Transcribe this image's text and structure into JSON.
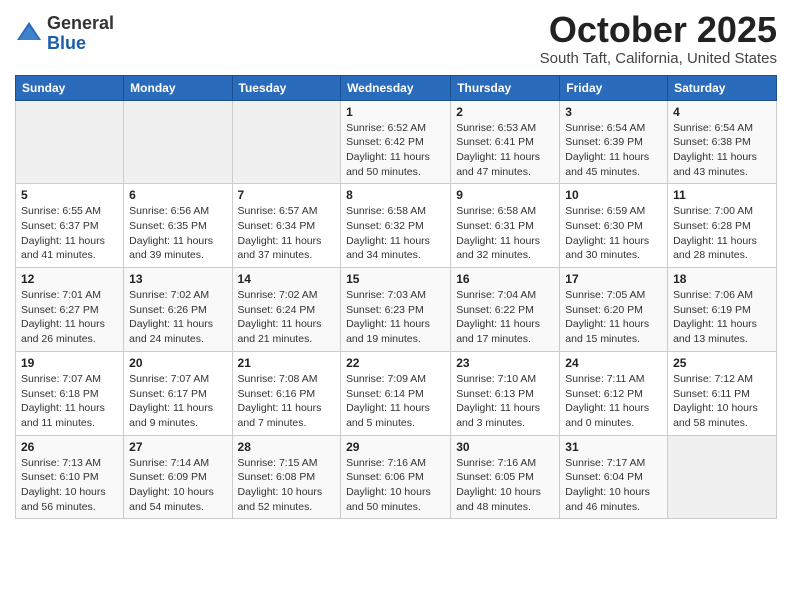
{
  "header": {
    "logo_line1": "General",
    "logo_line2": "Blue",
    "month": "October 2025",
    "location": "South Taft, California, United States"
  },
  "weekdays": [
    "Sunday",
    "Monday",
    "Tuesday",
    "Wednesday",
    "Thursday",
    "Friday",
    "Saturday"
  ],
  "weeks": [
    [
      {
        "day": "",
        "info": ""
      },
      {
        "day": "",
        "info": ""
      },
      {
        "day": "",
        "info": ""
      },
      {
        "day": "1",
        "info": "Sunrise: 6:52 AM\nSunset: 6:42 PM\nDaylight: 11 hours\nand 50 minutes."
      },
      {
        "day": "2",
        "info": "Sunrise: 6:53 AM\nSunset: 6:41 PM\nDaylight: 11 hours\nand 47 minutes."
      },
      {
        "day": "3",
        "info": "Sunrise: 6:54 AM\nSunset: 6:39 PM\nDaylight: 11 hours\nand 45 minutes."
      },
      {
        "day": "4",
        "info": "Sunrise: 6:54 AM\nSunset: 6:38 PM\nDaylight: 11 hours\nand 43 minutes."
      }
    ],
    [
      {
        "day": "5",
        "info": "Sunrise: 6:55 AM\nSunset: 6:37 PM\nDaylight: 11 hours\nand 41 minutes."
      },
      {
        "day": "6",
        "info": "Sunrise: 6:56 AM\nSunset: 6:35 PM\nDaylight: 11 hours\nand 39 minutes."
      },
      {
        "day": "7",
        "info": "Sunrise: 6:57 AM\nSunset: 6:34 PM\nDaylight: 11 hours\nand 37 minutes."
      },
      {
        "day": "8",
        "info": "Sunrise: 6:58 AM\nSunset: 6:32 PM\nDaylight: 11 hours\nand 34 minutes."
      },
      {
        "day": "9",
        "info": "Sunrise: 6:58 AM\nSunset: 6:31 PM\nDaylight: 11 hours\nand 32 minutes."
      },
      {
        "day": "10",
        "info": "Sunrise: 6:59 AM\nSunset: 6:30 PM\nDaylight: 11 hours\nand 30 minutes."
      },
      {
        "day": "11",
        "info": "Sunrise: 7:00 AM\nSunset: 6:28 PM\nDaylight: 11 hours\nand 28 minutes."
      }
    ],
    [
      {
        "day": "12",
        "info": "Sunrise: 7:01 AM\nSunset: 6:27 PM\nDaylight: 11 hours\nand 26 minutes."
      },
      {
        "day": "13",
        "info": "Sunrise: 7:02 AM\nSunset: 6:26 PM\nDaylight: 11 hours\nand 24 minutes."
      },
      {
        "day": "14",
        "info": "Sunrise: 7:02 AM\nSunset: 6:24 PM\nDaylight: 11 hours\nand 21 minutes."
      },
      {
        "day": "15",
        "info": "Sunrise: 7:03 AM\nSunset: 6:23 PM\nDaylight: 11 hours\nand 19 minutes."
      },
      {
        "day": "16",
        "info": "Sunrise: 7:04 AM\nSunset: 6:22 PM\nDaylight: 11 hours\nand 17 minutes."
      },
      {
        "day": "17",
        "info": "Sunrise: 7:05 AM\nSunset: 6:20 PM\nDaylight: 11 hours\nand 15 minutes."
      },
      {
        "day": "18",
        "info": "Sunrise: 7:06 AM\nSunset: 6:19 PM\nDaylight: 11 hours\nand 13 minutes."
      }
    ],
    [
      {
        "day": "19",
        "info": "Sunrise: 7:07 AM\nSunset: 6:18 PM\nDaylight: 11 hours\nand 11 minutes."
      },
      {
        "day": "20",
        "info": "Sunrise: 7:07 AM\nSunset: 6:17 PM\nDaylight: 11 hours\nand 9 minutes."
      },
      {
        "day": "21",
        "info": "Sunrise: 7:08 AM\nSunset: 6:16 PM\nDaylight: 11 hours\nand 7 minutes."
      },
      {
        "day": "22",
        "info": "Sunrise: 7:09 AM\nSunset: 6:14 PM\nDaylight: 11 hours\nand 5 minutes."
      },
      {
        "day": "23",
        "info": "Sunrise: 7:10 AM\nSunset: 6:13 PM\nDaylight: 11 hours\nand 3 minutes."
      },
      {
        "day": "24",
        "info": "Sunrise: 7:11 AM\nSunset: 6:12 PM\nDaylight: 11 hours\nand 0 minutes."
      },
      {
        "day": "25",
        "info": "Sunrise: 7:12 AM\nSunset: 6:11 PM\nDaylight: 10 hours\nand 58 minutes."
      }
    ],
    [
      {
        "day": "26",
        "info": "Sunrise: 7:13 AM\nSunset: 6:10 PM\nDaylight: 10 hours\nand 56 minutes."
      },
      {
        "day": "27",
        "info": "Sunrise: 7:14 AM\nSunset: 6:09 PM\nDaylight: 10 hours\nand 54 minutes."
      },
      {
        "day": "28",
        "info": "Sunrise: 7:15 AM\nSunset: 6:08 PM\nDaylight: 10 hours\nand 52 minutes."
      },
      {
        "day": "29",
        "info": "Sunrise: 7:16 AM\nSunset: 6:06 PM\nDaylight: 10 hours\nand 50 minutes."
      },
      {
        "day": "30",
        "info": "Sunrise: 7:16 AM\nSunset: 6:05 PM\nDaylight: 10 hours\nand 48 minutes."
      },
      {
        "day": "31",
        "info": "Sunrise: 7:17 AM\nSunset: 6:04 PM\nDaylight: 10 hours\nand 46 minutes."
      },
      {
        "day": "",
        "info": ""
      }
    ]
  ]
}
